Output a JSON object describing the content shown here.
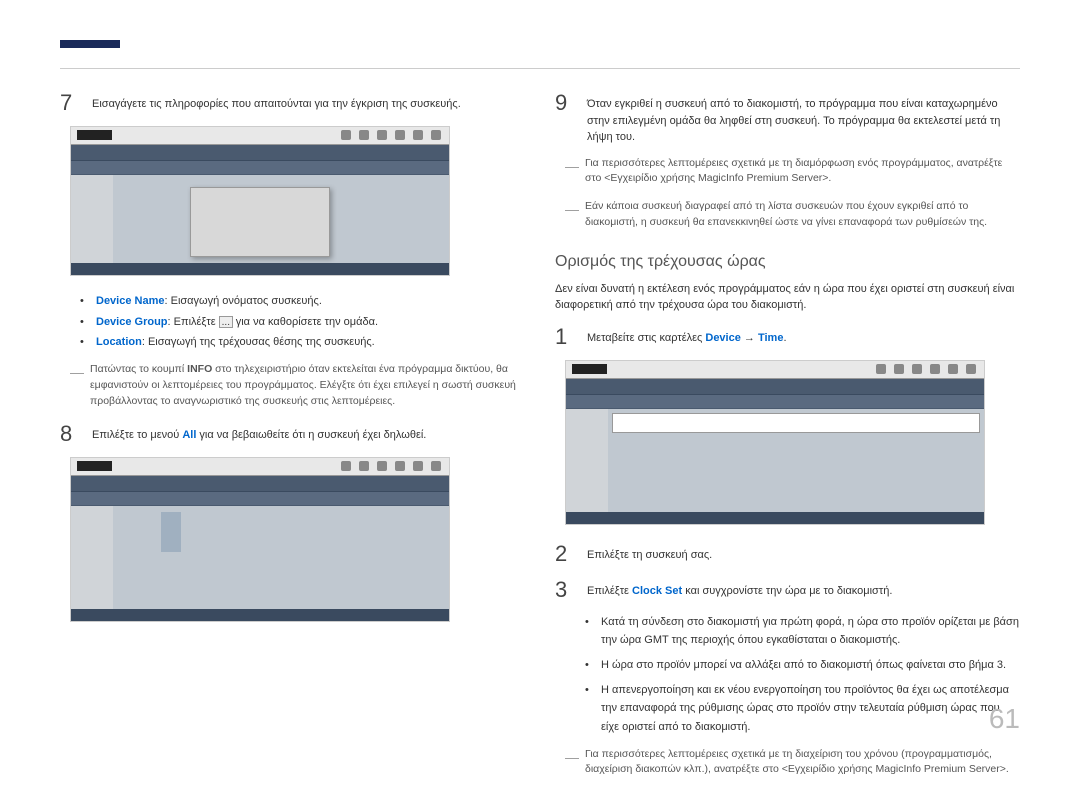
{
  "page_number": "61",
  "left": {
    "step7": {
      "num": "7",
      "text": "Εισαγάγετε τις πληροφορίες που απαιτούνται για την έγκριση της συσκευής."
    },
    "bullets": {
      "b1_label": "Device Name",
      "b1_text": ": Εισαγωγή ονόματος συσκευής.",
      "b2_label": "Device Group",
      "b2_text1": ": Επιλέξτε ",
      "b2_text2": " για να καθορίσετε την ομάδα.",
      "b3_label": "Location",
      "b3_text": ": Εισαγωγή της τρέχουσας θέσης της συσκευής."
    },
    "note1_pre": "Πατώντας το κουμπί ",
    "note1_bold": "INFO",
    "note1_post": " στο τηλεχειριστήριο όταν εκτελείται ένα πρόγραμμα δικτύου, θα εμφανιστούν οι λεπτομέρειες του προγράμματος. Ελέγξτε ότι έχει επιλεγεί η σωστή συσκευή προβάλλοντας το αναγνωριστικό της συσκευής στις λεπτομέρειες.",
    "step8": {
      "num": "8",
      "text_pre": "Επιλέξτε το μενού ",
      "text_bold": "All",
      "text_post": " για να βεβαιωθείτε ότι η συσκευή έχει δηλωθεί."
    }
  },
  "right": {
    "step9": {
      "num": "9",
      "text": "Όταν εγκριθεί η συσκευή από το διακομιστή, το πρόγραμμα που είναι καταχωρημένο στην επιλεγμένη ομάδα θα ληφθεί στη συσκευή. Το πρόγραμμα θα εκτελεστεί μετά τη λήψη του."
    },
    "note2": "Για περισσότερες λεπτομέρειες σχετικά με τη διαμόρφωση ενός προγράμματος, ανατρέξτε στο <Εγχειρίδιο χρήσης MagicInfo Premium Server>.",
    "note3": "Εάν κάποια συσκευή διαγραφεί από τη λίστα συσκευών που έχουν εγκριθεί από το διακομιστή, η συσκευή θα επανεκκινηθεί ώστε να γίνει επαναφορά των ρυθμίσεών της.",
    "section_title": "Ορισμός της τρέχουσας ώρας",
    "section_intro": "Δεν είναι δυνατή η εκτέλεση ενός προγράμματος εάν η ώρα που έχει οριστεί στη συσκευή είναι διαφορετική από την τρέχουσα ώρα του διακομιστή.",
    "step1": {
      "num": "1",
      "text_pre": "Μεταβείτε στις καρτέλες ",
      "text_blue1": "Device",
      "text_arrow": " → ",
      "text_blue2": "Time",
      "text_post": "."
    },
    "step2": {
      "num": "2",
      "text": "Επιλέξτε τη συσκευή σας."
    },
    "step3": {
      "num": "3",
      "text_pre": "Επιλέξτε ",
      "text_blue": "Clock Set",
      "text_post": " και συγχρονίστε την ώρα με το διακομιστή."
    },
    "sub1": "Κατά τη σύνδεση στο διακομιστή για πρώτη φορά, η ώρα στο προϊόν ορίζεται με βάση την ώρα GMT της περιοχής όπου εγκαθίσταται ο διακομιστής.",
    "sub2": "Η ώρα στο προϊόν μπορεί να αλλάξει από το διακομιστή όπως φαίνεται στο βήμα 3.",
    "sub3": "Η απενεργοποίηση και εκ νέου ενεργοποίηση του προϊόντος θα έχει ως αποτέλεσμα την επαναφορά της ρύθμισης ώρας στο προϊόν στην τελευταία ρύθμιση ώρας που είχε οριστεί από το διακομιστή.",
    "note4": "Για περισσότερες λεπτομέρειες σχετικά με τη διαχείριση του χρόνου (προγραμματισμός, διαχείριση διακοπών κλπ.), ανατρέξτε στο <Εγχειρίδιο χρήσης MagicInfo Premium Server>."
  }
}
